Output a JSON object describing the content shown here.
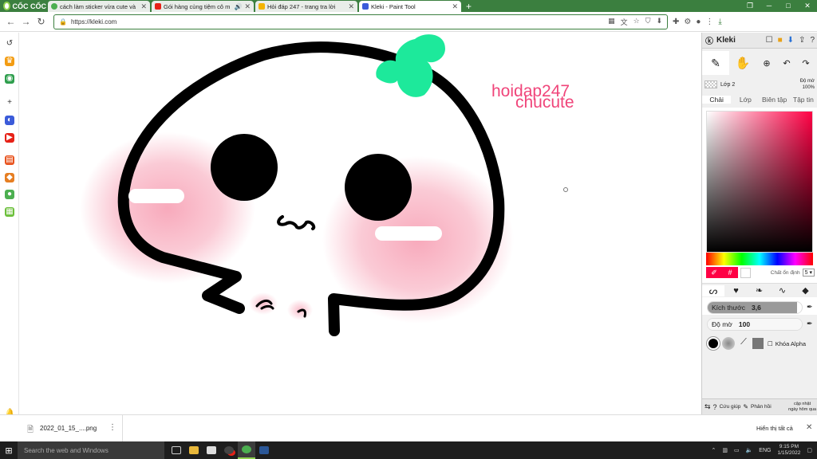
{
  "browser": {
    "brand": "CỐC CỐC",
    "tabs": [
      {
        "title": "cách làm sticker vừa cute và",
        "favicon_color": "#4caf50"
      },
      {
        "title": "Gói hàng cùng tiệm cô m",
        "favicon_color": "#e62117"
      },
      {
        "title": "Hỏi đáp 247 - trang tra lời",
        "favicon_color": "#f4b400"
      },
      {
        "title": "Kleki - Paint Tool",
        "favicon_color": "#3b5bd9"
      }
    ],
    "new_tab": "+",
    "url": "https://kleki.com"
  },
  "canvas": {
    "text_line1": "hoidap247",
    "text_line2": "chucute",
    "text_color": "#f0457a",
    "leaf_color": "#1de99b",
    "blush_color": "#f7a0b4"
  },
  "panel": {
    "app_name": "Kleki",
    "layer_label": "Lớp 2",
    "opacity_label": "Độ mờ",
    "opacity_value": "100%",
    "tabs": [
      "Chải",
      "Lớp",
      "Biên tập",
      "Tập tin"
    ],
    "active_tab": 0,
    "hue_color": "#ff0044",
    "hex_label": "#",
    "stabilizer_label": "Chất ổn định",
    "stabilizer_value": "5",
    "size_label": "Kích thước",
    "size_value": "3,6",
    "size_fraction": 0.95,
    "brush_opacity_label": "Độ mờ",
    "brush_opacity_value": "100",
    "brush_opacity_fraction": 1.0,
    "alpha_lock_label": "Khóa Alpha",
    "help_label": "Cứu giúp",
    "feedback_label": "Phản hồi",
    "updated_label1": "cập nhật",
    "updated_label2": "ngày hôm qua"
  },
  "downloads": {
    "file_name": "2022_01_15_....png",
    "show_all": "Hiển thị tất cả"
  },
  "taskbar": {
    "search_placeholder": "Search the web and Windows",
    "language": "ENG",
    "time": "9:15 PM",
    "date": "1/15/2022"
  }
}
